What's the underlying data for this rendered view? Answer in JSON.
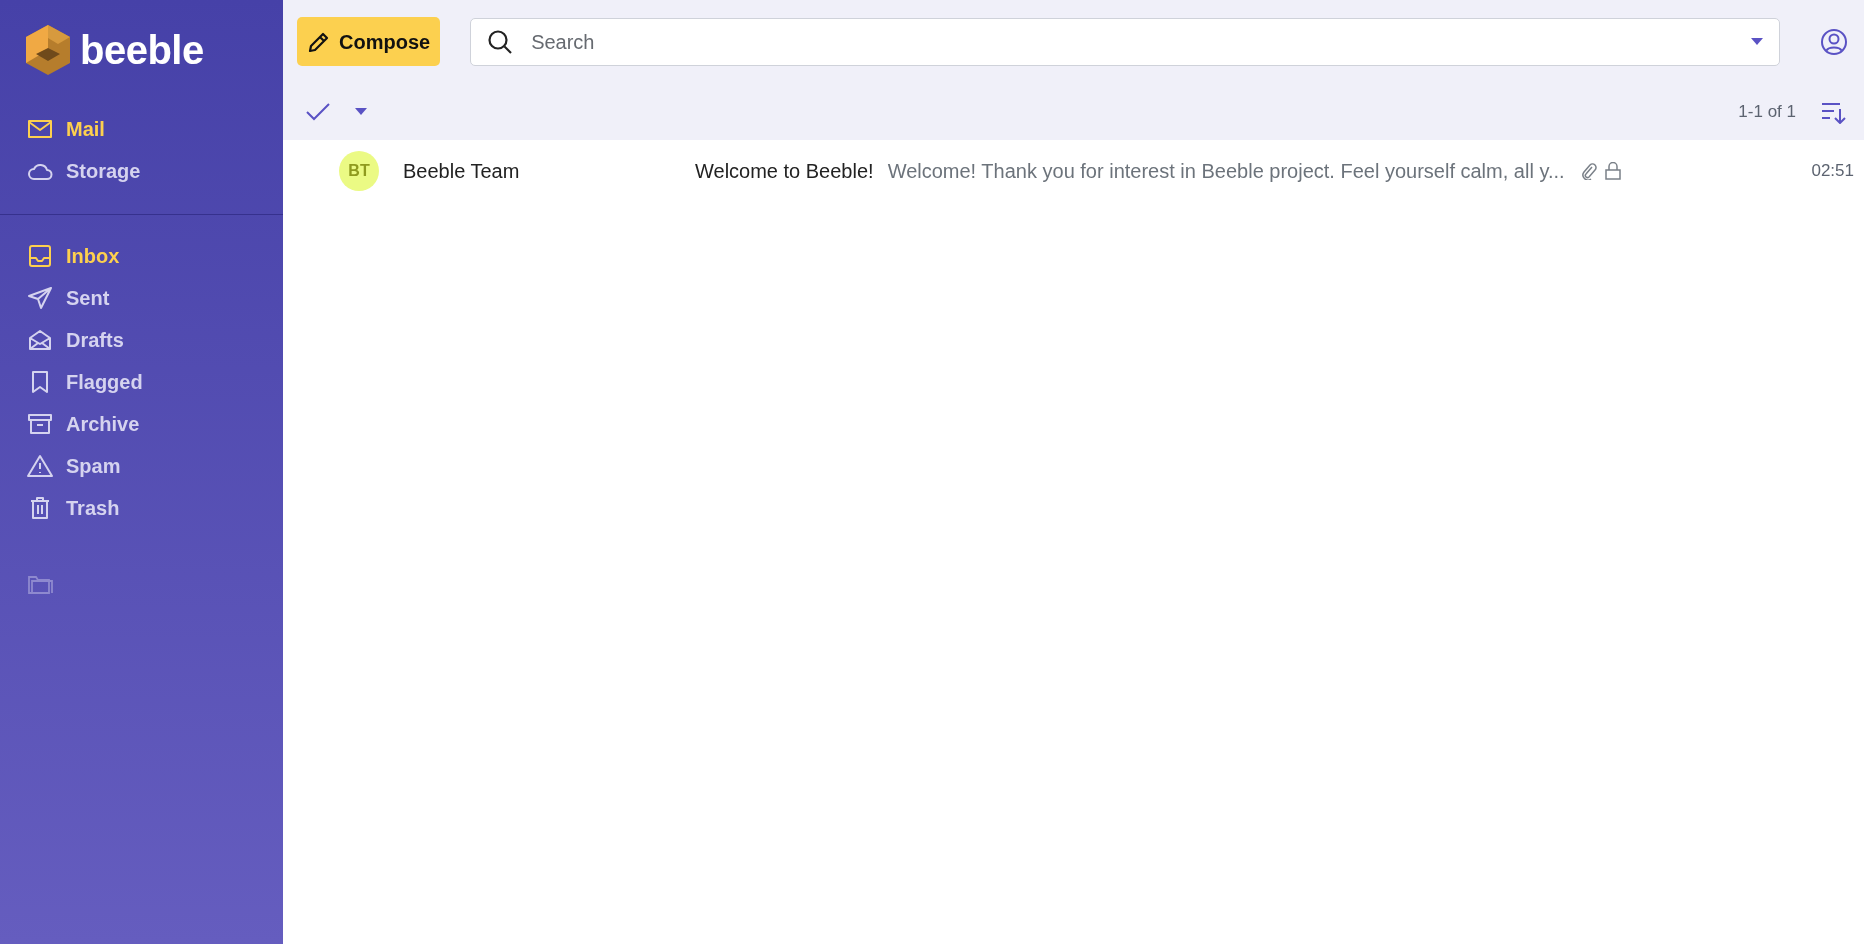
{
  "app": {
    "logo_text": "beeble"
  },
  "apps": [
    {
      "label": "Mail",
      "selected": true
    },
    {
      "label": "Storage",
      "selected": false
    }
  ],
  "folders": [
    {
      "label": "Inbox",
      "selected": true
    },
    {
      "label": "Sent",
      "selected": false
    },
    {
      "label": "Drafts",
      "selected": false
    },
    {
      "label": "Flagged",
      "selected": false
    },
    {
      "label": "Archive",
      "selected": false
    },
    {
      "label": "Spam",
      "selected": false
    },
    {
      "label": "Trash",
      "selected": false
    }
  ],
  "compose": {
    "label": "Compose"
  },
  "search": {
    "placeholder": "Search"
  },
  "toolbar": {
    "count": "1-1 of 1"
  },
  "messages": [
    {
      "initials": "BT",
      "color": "#ebfa84",
      "sender": "Beeble Team",
      "subject": "Welcome to Beeble!",
      "preview": "Welcome! Thank you for interest in Beeble project. Feel yourself calm, all y...",
      "has_attachment": true,
      "encrypted": true,
      "time": "02:51"
    }
  ]
}
